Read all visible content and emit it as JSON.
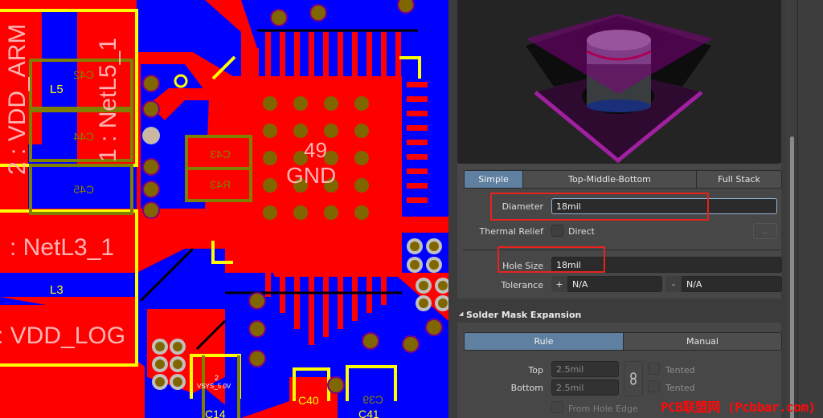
{
  "pcb": {
    "net_labels": {
      "vdd_arm": "2 : VDD_ARM",
      "netl5": "1 : NetL5_1",
      "netl3": ": NetL3_1",
      "vdd_log": ": VDD_LOG",
      "gnd_pad_number": "49",
      "gnd_net": "GND"
    },
    "designators": {
      "l5": "L5",
      "c42": "C42",
      "c44": "C44",
      "c45": "C45",
      "c43": "C43",
      "r43": "R43",
      "l3": "L3",
      "c14": "C14",
      "c40": "C40",
      "c39": "C39",
      "c41": "C41",
      "pin2": "2",
      "vsys": "VSYS_5.0V"
    },
    "colors": {
      "top_layer": "#ff0000",
      "bottom_layer": "#0000ff",
      "silkscreen": "#ffff00",
      "pad": "#806600",
      "overlay": "#808000"
    }
  },
  "panel": {
    "stack_tabs": [
      {
        "label": "Simple",
        "active": true
      },
      {
        "label": "Top-Middle-Bottom",
        "active": false
      },
      {
        "label": "Full Stack",
        "active": false
      }
    ],
    "diameter": {
      "label": "Diameter",
      "value": "18mil"
    },
    "thermal_relief": {
      "label": "Thermal Relief",
      "checkbox_label": "Direct",
      "checked": false,
      "more_button": "..."
    },
    "hole_size": {
      "label": "Hole Size",
      "value": "18mil"
    },
    "tolerance": {
      "label": "Tolerance",
      "plus_sign": "+",
      "plus_value": "N/A",
      "minus_sign": "-",
      "minus_value": "N/A"
    },
    "solder_mask": {
      "title": "Solder Mask Expansion",
      "collapse_glyph": "◢",
      "mode_tabs": [
        {
          "label": "Rule",
          "active": true
        },
        {
          "label": "Manual",
          "active": false
        }
      ],
      "top": {
        "label": "Top",
        "value": "2.5mil",
        "tented_label": "Tented",
        "tented": false
      },
      "bottom": {
        "label": "Bottom",
        "value": "2.5mil",
        "tented_label": "Tented",
        "tented": false
      },
      "from_hole_edge": {
        "label": "From Hole Edge",
        "checked": false
      }
    }
  },
  "watermark": "PCB联盟网 (Pcbbar.com)"
}
